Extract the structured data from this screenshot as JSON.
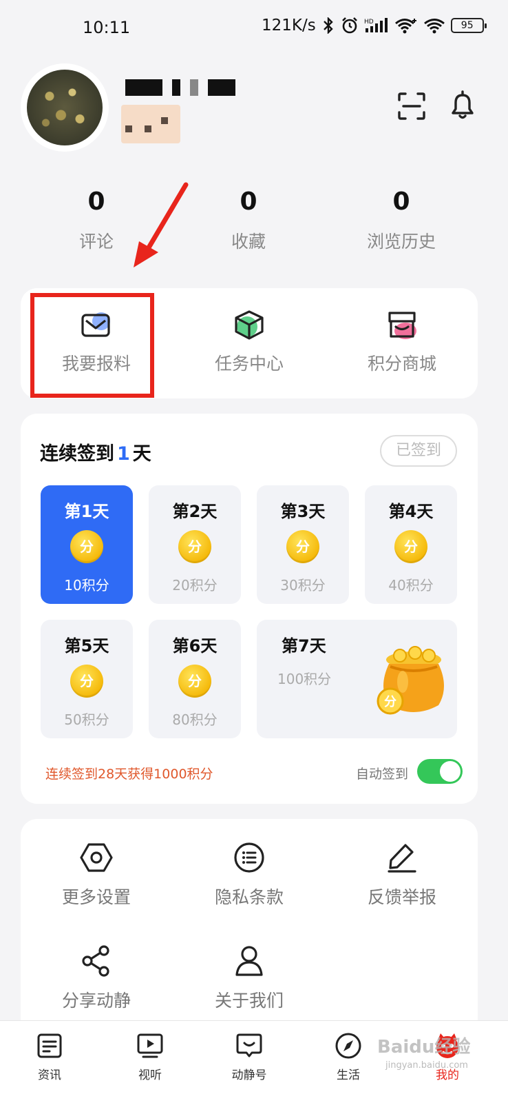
{
  "status_bar": {
    "time": "10:11",
    "speed": "121K/s",
    "battery": "95"
  },
  "stats": [
    {
      "value": "0",
      "label": "评论"
    },
    {
      "value": "0",
      "label": "收藏"
    },
    {
      "value": "0",
      "label": "浏览历史"
    }
  ],
  "quick_actions": [
    {
      "label": "我要报料",
      "icon": "envelope-icon"
    },
    {
      "label": "任务中心",
      "icon": "box-icon"
    },
    {
      "label": "积分商城",
      "icon": "store-icon"
    }
  ],
  "signin": {
    "title_prefix": "连续签到",
    "days_count": "1",
    "title_suffix": "天",
    "signed_button": "已签到",
    "coin_text": "分",
    "days": [
      {
        "title": "第1天",
        "points": "10积分"
      },
      {
        "title": "第2天",
        "points": "20积分"
      },
      {
        "title": "第3天",
        "points": "30积分"
      },
      {
        "title": "第4天",
        "points": "40积分"
      },
      {
        "title": "第5天",
        "points": "50积分"
      },
      {
        "title": "第6天",
        "points": "80积分"
      },
      {
        "title": "第7天",
        "points": "100积分"
      }
    ],
    "promo": "连续签到28天获得1000积分",
    "auto_label": "自动签到",
    "auto_enabled": true
  },
  "settings": [
    {
      "label": "更多设置",
      "icon": "hexagon-nut-icon"
    },
    {
      "label": "隐私条款",
      "icon": "list-icon"
    },
    {
      "label": "反馈举报",
      "icon": "pen-icon"
    },
    {
      "label": "分享动静",
      "icon": "share-icon"
    },
    {
      "label": "关于我们",
      "icon": "person-icon"
    }
  ],
  "tabs": [
    {
      "label": "资讯",
      "icon": "news-icon"
    },
    {
      "label": "视听",
      "icon": "play-icon"
    },
    {
      "label": "动静号",
      "icon": "chat-icon"
    },
    {
      "label": "生活",
      "icon": "compass-icon"
    },
    {
      "label": "我的",
      "icon": "mascot-icon"
    }
  ],
  "active_tab": "我的",
  "watermark": {
    "brand": "Baidu经验",
    "url": "jingyan.baidu.com"
  },
  "colors": {
    "accent_blue": "#2f6bf5",
    "highlight_red": "#e8251c",
    "toggle_green": "#34c759",
    "promo_orange": "#e0582c"
  }
}
